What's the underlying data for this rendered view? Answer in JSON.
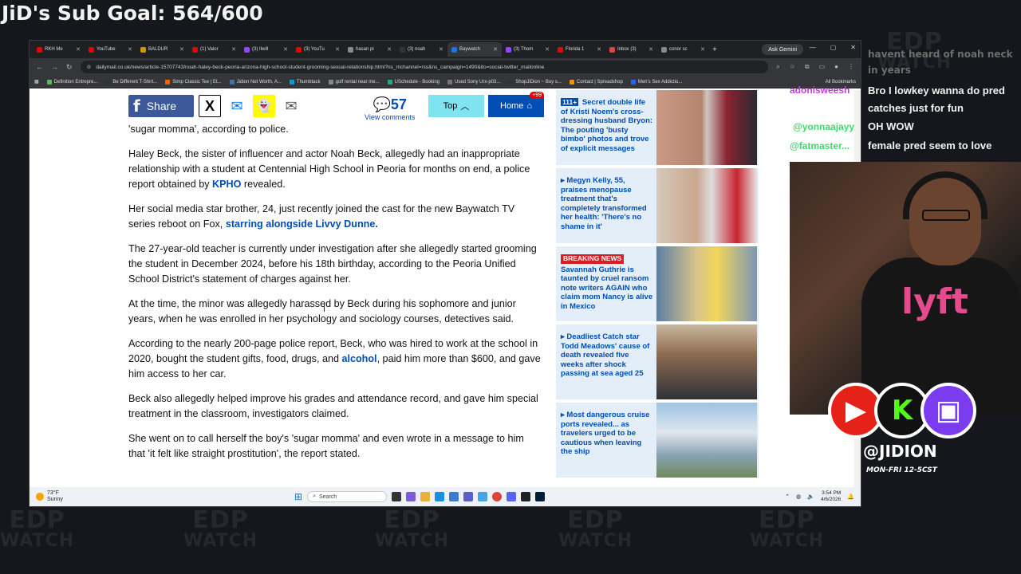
{
  "stream": {
    "sub_goal": "JiD's Sub Goal: 564/600",
    "handle": "@JIDION",
    "schedule": "MON-FRI 12-5CST",
    "bg_logo_top": "EDP",
    "bg_logo_bottom": "WATCH"
  },
  "browser": {
    "tabs": [
      {
        "label": "RKH Me",
        "color": "#e00"
      },
      {
        "label": "YouTube",
        "color": "#e00"
      },
      {
        "label": "BALDUR",
        "color": "#c90"
      },
      {
        "label": "(1) Valor",
        "color": "#e00"
      },
      {
        "label": "(3) Ilwill",
        "color": "#9146ff"
      },
      {
        "label": "(3) YouTu",
        "color": "#e00"
      },
      {
        "label": "hasan pi",
        "color": "#888"
      },
      {
        "label": "(3) noah",
        "color": "#333"
      },
      {
        "label": "Baywatch",
        "color": "#1a73e8",
        "active": true
      },
      {
        "label": "(3) Thom",
        "color": "#9146ff"
      },
      {
        "label": "Florida 1",
        "color": "#e00"
      },
      {
        "label": "Inbox (3)",
        "color": "#d44"
      },
      {
        "label": "conor sc",
        "color": "#888"
      }
    ],
    "gemini_label": "Ask Gemini",
    "url": "dailymail.co.uk/news/article-15707743/noah-haley-beck-peoria-arizona-high-school-student-grooming-sexual-relationship.html?ns_mchannel=rss&ns_campaign=1490&ito=social-twitter_mailonline",
    "bookmarks": [
      {
        "label": "Definition Entrepre...",
        "color": "#5cb85c"
      },
      {
        "label": "Be Different T-Shirt...",
        "color": "#333"
      },
      {
        "label": "Simp Classic Tee | Et...",
        "color": "#f56400"
      },
      {
        "label": "Jidion Net Worth, A...",
        "color": "#4a6fa5"
      },
      {
        "label": "Thumbtack",
        "color": "#009fd9"
      },
      {
        "label": "golf rental near me...",
        "color": "#888"
      },
      {
        "label": "USchedule - Booking",
        "color": "#2a7"
      },
      {
        "label": "Used Sony Urx-p03...",
        "color": "#777"
      },
      {
        "label": "ShopJiDion ~ Buy s...",
        "color": "#333"
      },
      {
        "label": "Contact | Spreadshop",
        "color": "#f39200"
      },
      {
        "label": "Men's Sex Addictio...",
        "color": "#2962ff"
      }
    ],
    "all_bookmarks": "All Bookmarks"
  },
  "share": {
    "facebook": "Share",
    "comment_count": "57",
    "comment_label": "View comments",
    "top": "Top",
    "home": "Home",
    "home_badge": "+99"
  },
  "article": {
    "p0": "'sugar momma', according to police.",
    "p1a": "Haley Beck, the sister of influencer and actor Noah Beck, allegedly had an inappropriate relationship with a student at Centennial High School in Peoria for months on end, a police report obtained by ",
    "p1link": "KPHO",
    "p1b": " revealed.",
    "p2a": "Her social media star brother, 24, just recently joined the cast for the new Baywatch TV series reboot on Fox, ",
    "p2link": "starring alongside Livvy Dunne.",
    "p3": "The 27-year-old teacher is currently under investigation after she allegedly started grooming the student in December 2024, before his 18th birthday, according to the Peoria Unified School District's statement of charges against her.",
    "p4": "At the time, the minor was allegedly harassed by Beck during his sophomore and junior years, when he was enrolled in her psychology and sociology courses, detectives said.",
    "p5a": "According to the nearly 200-page police report, Beck, who was hired to work at the school in 2020, bought the student gifts, food, drugs, and ",
    "p5link": "alcohol",
    "p5b": ", paid him more than $600, and gave him access to her car.",
    "p6": "Beck also allegedly helped improve his grades and attendance record, and gave him special treatment in the classroom, investigators claimed.",
    "p7": "She went on to call herself the boy's 'sugar momma' and even wrote in a message to him that 'it felt like straight prostitution', the report stated."
  },
  "sidebar": [
    {
      "tag_plus": "111+",
      "text": "Secret double life of Kristi Noem's cross-dressing husband Bryon: The pouting 'busty bimbo' photos and trove of explicit messages"
    },
    {
      "text": "Megyn Kelly, 55, praises menopause treatment that's completely transformed her health: 'There's no shame in it'"
    },
    {
      "tag": "BREAKING NEWS",
      "text": "Savannah Guthrie is taunted by cruel ransom note writers AGAIN who claim mom Nancy is alive in Mexico"
    },
    {
      "text": "Deadliest Catch star Todd Meadows' cause of death revealed five weeks after shock passing at sea aged 25"
    },
    {
      "text": "Most dangerous cruise ports revealed... as travelers urged to be cautious when leaving the ship"
    }
  ],
  "taskbar": {
    "temp": "73°F",
    "condition": "Sunny",
    "search": "Search",
    "time": "3:54 PM",
    "date": "4/6/2026"
  },
  "chat": {
    "faded_top": "havent heard of noah neck in years",
    "user1": "adonisweesh",
    "msg1": "Bro I lowkey wanna do pred catches just for fun",
    "user2": "@yonnaajayy",
    "msg2": "OH WOW",
    "user3": "@fatmaster...",
    "msg3": "female pred seem to love"
  },
  "colors": {
    "link_blue": "#004db3",
    "facebook": "#3b5998",
    "top_button": "#7fe3f0",
    "breaking": "#e21b23",
    "chat_user1": "#c13ddc",
    "chat_user2": "#3fd96b"
  }
}
